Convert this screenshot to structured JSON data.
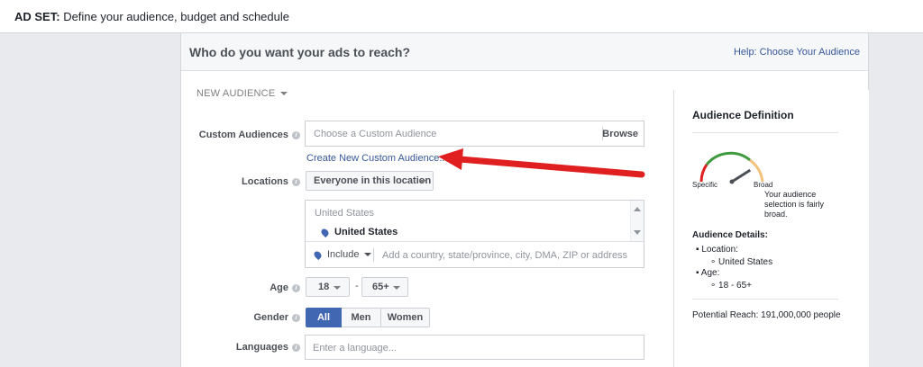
{
  "header": {
    "prefix": "AD SET:",
    "text": "Define your audience, budget and schedule"
  },
  "panel": {
    "title": "Who do you want your ads to reach?",
    "help_link": "Help: Choose Your Audience"
  },
  "new_audience": {
    "label": "NEW AUDIENCE"
  },
  "custom_audiences": {
    "label": "Custom Audiences",
    "placeholder": "Choose a Custom Audience",
    "browse": "Browse",
    "create_link": "Create New Custom Audience..."
  },
  "locations": {
    "label": "Locations",
    "dropdown": "Everyone in this location",
    "list_header": "United States",
    "selected": "United States",
    "include": "Include",
    "placeholder": "Add a country, state/province, city, DMA, ZIP or address"
  },
  "age": {
    "label": "Age",
    "min": "18",
    "separator": "-",
    "max": "65+"
  },
  "gender": {
    "label": "Gender",
    "options": [
      "All",
      "Men",
      "Women"
    ],
    "selected": "All"
  },
  "languages": {
    "label": "Languages",
    "placeholder": "Enter a language..."
  },
  "sidebar": {
    "title": "Audience Definition",
    "gauge": {
      "specific": "Specific",
      "broad": "Broad",
      "level": 0.82
    },
    "gauge_text": [
      "Your audience",
      "selection is fairly",
      "broad."
    ],
    "details_title": "Audience Details:",
    "location_label": "Location:",
    "location_value": "United States",
    "age_label": "Age:",
    "age_value": "18 - 65+",
    "reach": "Potential Reach: 191,000,000 people"
  },
  "colors": {
    "link": "#365899",
    "active": "#4267b2",
    "arrow": "#e02020"
  }
}
